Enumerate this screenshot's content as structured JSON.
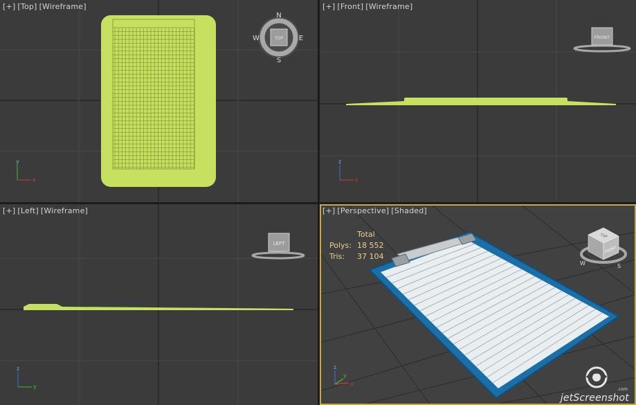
{
  "viewports": {
    "top": {
      "plus": "[+]",
      "view": "[Top]",
      "mode": "[Wireframe]",
      "cube_label": "TOP",
      "compass": {
        "n": "N",
        "s": "S",
        "e": "E",
        "w": "W"
      }
    },
    "front": {
      "plus": "[+]",
      "view": "[Front]",
      "mode": "[Wireframe]",
      "cube_label": "FRONT"
    },
    "left": {
      "plus": "[+]",
      "view": "[Left]",
      "mode": "[Wireframe]",
      "cube_label": "LEFT"
    },
    "perspective": {
      "plus": "[+]",
      "view": "[Perspective]",
      "mode": "[Shaded]",
      "cube_labels": {
        "top": "TOP",
        "front": "FRONT"
      },
      "active": true
    }
  },
  "stats": {
    "header": "Total",
    "polys_label": "Polys:",
    "polys_value": "18 552",
    "tris_label": "Tris:",
    "tris_value": "37 104"
  },
  "axes": {
    "x": "x",
    "y": "y",
    "z": "z"
  },
  "colors": {
    "wireframe": "#c8e060",
    "viewport_bg": "#3b3b3b",
    "active_border": "#c9a84a",
    "clipboard_blue": "#1a6fa8",
    "paper": "#e9eef0"
  },
  "watermark": {
    "brand": "jetScreenshot",
    "tld": ".com"
  }
}
